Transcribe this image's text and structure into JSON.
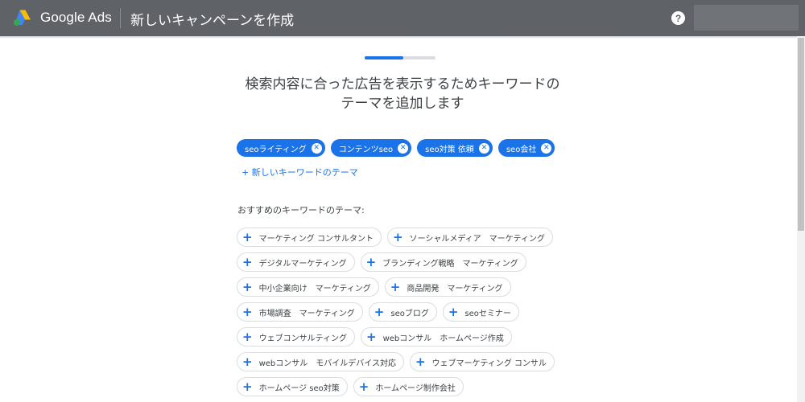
{
  "header": {
    "brand": "Google Ads",
    "title": "新しいキャンペーンを作成",
    "help_icon": "question-mark-icon",
    "help_glyph": "?"
  },
  "progress": {
    "fraction": 0.55
  },
  "heading": {
    "line1": "検索内容に合った広告を表示するためキーワードの",
    "line2": "テーマを追加します"
  },
  "selected_keywords": [
    "seoライティング",
    "コンテンツseo",
    "seo対策 依頼",
    "seo会社"
  ],
  "add_keyword_link": "+ 新しいキーワードのテーマ",
  "suggestions_label": "おすすめのキーワードのテーマ:",
  "suggestion_rows": [
    [
      "マーケティング コンサルタント",
      "ソーシャルメディア　マーケティング"
    ],
    [
      "デジタルマーケティング",
      "ブランディング戦略　マーケティング"
    ],
    [
      "中小企業向け　マーケティング",
      "商品開発　マーケティング"
    ],
    [
      "市場調査　マーケティング",
      "seoブログ",
      "seoセミナー"
    ],
    [
      "ウェブコンサルティング",
      "webコンサル　ホームページ作成"
    ],
    [
      "webコンサル　モバイルデバイス対応",
      "ウェブマーケティング コンサル"
    ],
    [
      "ホームページ seo対策",
      "ホームページ制作会社"
    ]
  ],
  "colors": {
    "topbar": "#5f6368",
    "accent": "#1a73e8",
    "chip_border": "#dadce0"
  }
}
